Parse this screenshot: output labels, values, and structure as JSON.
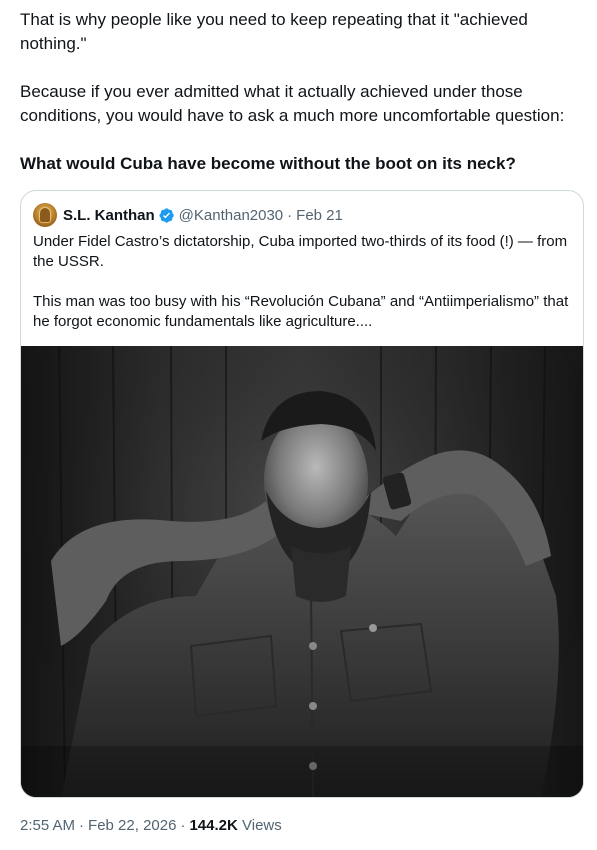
{
  "tweet": {
    "paragraph_1": "That is why people like you need to keep repeating that it \"achieved nothing.\"",
    "paragraph_2": "Because if you ever admitted what it actually achieved under those conditions, you would have to ask a much more uncomfortable question:",
    "paragraph_3": "What would Cuba have become without the boot on its neck?"
  },
  "quoted_tweet": {
    "author_name": "S.L. Kanthan",
    "handle": "@Kanthan2030",
    "separator": "·",
    "date": "Feb 21",
    "paragraph_1": "Under Fidel Castro’s dictatorship, Cuba imported two-thirds of its food (!) — from the USSR.",
    "paragraph_2": "This man was too busy with his “Revolución Cubana” and “Antiimperialismo” that he forgot economic fundamentals like agriculture....",
    "avatar_icon": "avatar-icon",
    "verified_icon": "verified-badge-icon",
    "verified_color": "#1d9bf0"
  },
  "meta": {
    "time": "2:55 AM",
    "separator": "·",
    "date": "Feb 22, 2026",
    "views_count": "144.2K",
    "views_label": "Views"
  },
  "colors": {
    "text_primary": "#0f1419",
    "text_secondary": "#536471",
    "border": "#cfd9de"
  }
}
